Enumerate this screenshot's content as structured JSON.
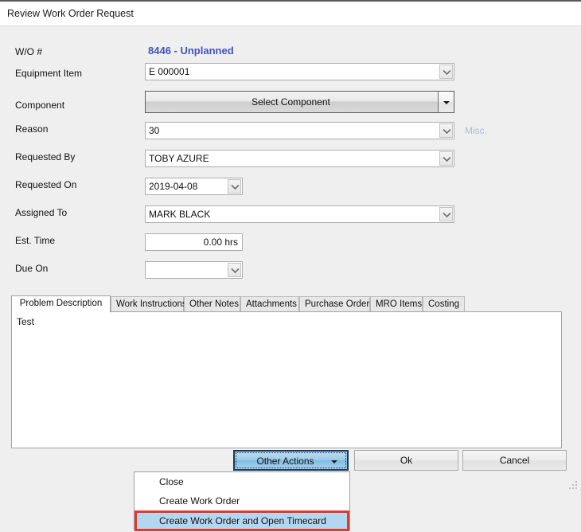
{
  "window": {
    "title": "Review Work Order Request"
  },
  "form": {
    "fields": [
      {
        "label": "W/O #",
        "value": "8446 - Unplanned",
        "type": "static-strong"
      },
      {
        "label": "Equipment Item",
        "value": "E 000001",
        "type": "combo"
      },
      {
        "label": "Component",
        "value": "Select Component",
        "type": "splitbutton"
      },
      {
        "label": "Reason",
        "value": "30",
        "type": "combo",
        "note": "Misc."
      },
      {
        "label": "Requested By",
        "value": "TOBY AZURE",
        "type": "combo"
      },
      {
        "label": "Requested On",
        "value": "2019-04-08",
        "type": "combo-date"
      },
      {
        "label": "Assigned To",
        "value": "MARK BLACK",
        "type": "combo"
      },
      {
        "label": "Est. Time",
        "value": "0.00 hrs",
        "type": "text-right"
      },
      {
        "label": "Due On",
        "value": "",
        "type": "combo-date"
      }
    ]
  },
  "tabs": {
    "active_index": 0,
    "items": [
      {
        "label": "Problem Description"
      },
      {
        "label": "Work Instructions"
      },
      {
        "label": "Other Notes"
      },
      {
        "label": "Attachments"
      },
      {
        "label": "Purchase Orders"
      },
      {
        "label": "MRO Items"
      },
      {
        "label": "Costing"
      }
    ]
  },
  "panel": {
    "content": "Test"
  },
  "buttons": {
    "other_actions": "Other Actions",
    "ok": "Ok",
    "cancel": "Cancel"
  },
  "menu": {
    "selected_index": 2,
    "items": [
      {
        "label": "Close"
      },
      {
        "label": "Create Work Order"
      },
      {
        "label": "Create Work Order and Open Timecard"
      }
    ]
  },
  "colors": {
    "window_bg": "#efefef",
    "titlebar_bg": "#ffffff",
    "accent_blue_text": "#4255bb",
    "note_blue": "#a9bcd4",
    "button_blue": "#9dcbea",
    "menu_highlight": "#b3d7f0",
    "annotation_red": "#e03a2f"
  }
}
